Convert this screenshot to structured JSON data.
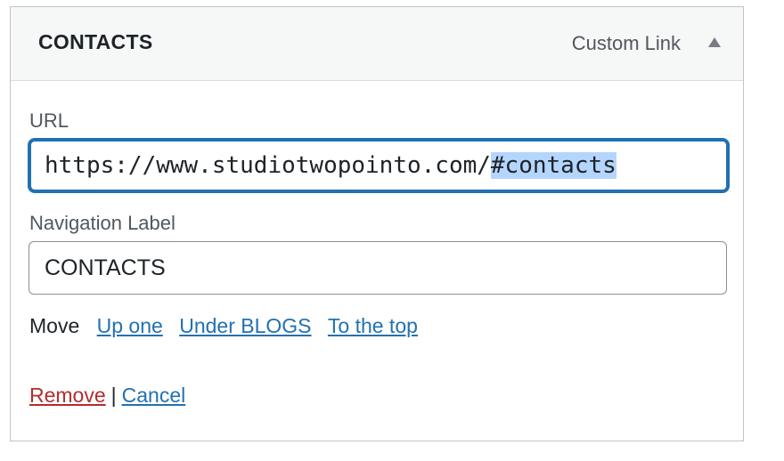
{
  "menu_item": {
    "title": "CONTACTS",
    "type_label": "Custom Link",
    "toggle_icon": "triangle-up-icon"
  },
  "url_field": {
    "label": "URL",
    "value_unselected": "https://www.studiotwopointo.com/",
    "value_selected": "#contacts"
  },
  "nav_label_field": {
    "label": "Navigation Label",
    "value": "CONTACTS"
  },
  "move": {
    "label": "Move",
    "links": [
      "Up one",
      "Under BLOGS",
      "To the top"
    ]
  },
  "actions": {
    "remove": "Remove",
    "separator": "|",
    "cancel": "Cancel"
  },
  "colors": {
    "link": "#2271b1",
    "remove_link": "#b32d2e",
    "focus_border": "#2271b1",
    "selection": "#b4d5fe"
  }
}
